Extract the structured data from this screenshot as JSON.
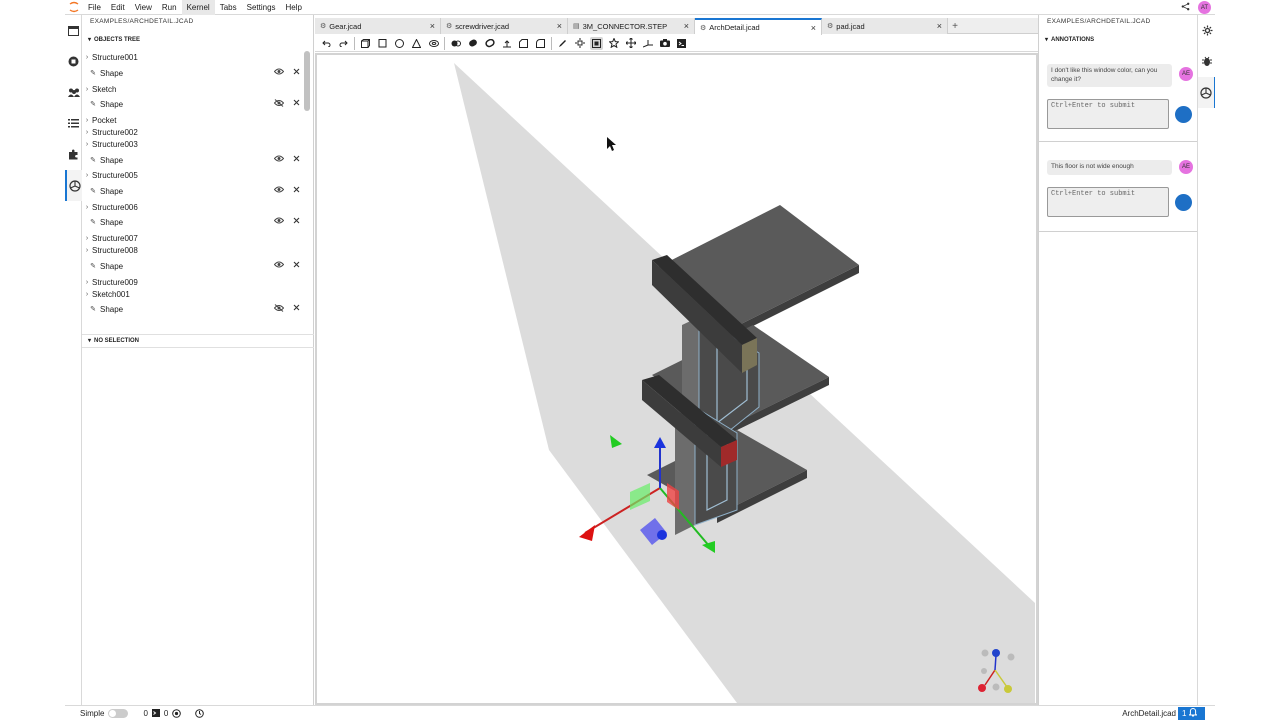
{
  "menubar": {
    "items": [
      "File",
      "Edit",
      "View",
      "Run",
      "Kernel",
      "Tabs",
      "Settings",
      "Help"
    ],
    "active": "Kernel",
    "avatar": "AT"
  },
  "left_panel": {
    "title": "EXAMPLES/ARCHDETAIL.JCAD",
    "objects_tree_label": "OBJECTS TREE",
    "tree": [
      {
        "label": "Structure001",
        "kind": "parent"
      },
      {
        "label": "Shape",
        "kind": "child",
        "visible": true
      },
      {
        "label": "Sketch",
        "kind": "parent"
      },
      {
        "label": "Shape",
        "kind": "child",
        "visible": false
      },
      {
        "label": "Pocket",
        "kind": "parent"
      },
      {
        "label": "Structure002",
        "kind": "parent"
      },
      {
        "label": "Structure003",
        "kind": "parent"
      },
      {
        "label": "Shape",
        "kind": "child",
        "visible": true
      },
      {
        "label": "Structure005",
        "kind": "parent"
      },
      {
        "label": "Shape",
        "kind": "child",
        "visible": true
      },
      {
        "label": "Structure006",
        "kind": "parent"
      },
      {
        "label": "Shape",
        "kind": "child",
        "visible": true
      },
      {
        "label": "Structure007",
        "kind": "parent"
      },
      {
        "label": "Structure008",
        "kind": "parent"
      },
      {
        "label": "Shape",
        "kind": "child",
        "visible": true
      },
      {
        "label": "Structure009",
        "kind": "parent"
      },
      {
        "label": "Sketch001",
        "kind": "parent"
      },
      {
        "label": "Shape",
        "kind": "child",
        "visible": false
      }
    ],
    "no_selection_label": "NO SELECTION"
  },
  "tabs": [
    {
      "label": "Gear.jcad",
      "active": false
    },
    {
      "label": "screwdriver.jcad",
      "active": false
    },
    {
      "label": "3M_CONNECTOR.STEP",
      "active": false
    },
    {
      "label": "ArchDetail.jcad",
      "active": true
    },
    {
      "label": "pad.jcad",
      "active": false
    }
  ],
  "toolbar_icons": [
    "undo-icon",
    "redo-icon",
    "box-icon",
    "cylinder-icon",
    "sphere-icon",
    "cone-icon",
    "torus-icon",
    "extrude-icon",
    "cut-icon",
    "intersection-icon",
    "union-icon",
    "chamfer-icon",
    "fillet-icon",
    "sketch-pencil-icon",
    "explode-icon",
    "clip-plane-icon",
    "star-icon",
    "transform-icon",
    "axes-icon",
    "camera-icon",
    "terminal-icon"
  ],
  "right_panel": {
    "title": "EXAMPLES/ARCHDETAIL.JCAD",
    "annotations_label": "ANNOTATIONS",
    "annotations": [
      {
        "text": "I don't like this window color, can you change it?",
        "author": "AE",
        "placeholder": "Ctrl+Enter to submit"
      },
      {
        "text": "This floor is not wide enough",
        "author": "AE",
        "placeholder": "Ctrl+Enter to submit"
      }
    ]
  },
  "statusbar": {
    "mode_label": "Simple",
    "count_a": "0",
    "count_b": "0",
    "filename": "ArchDetail.jcad",
    "notifications": "1"
  },
  "colors": {
    "accent": "#1976d2",
    "avatar": "#e573e0",
    "send": "#1e6fc5"
  }
}
